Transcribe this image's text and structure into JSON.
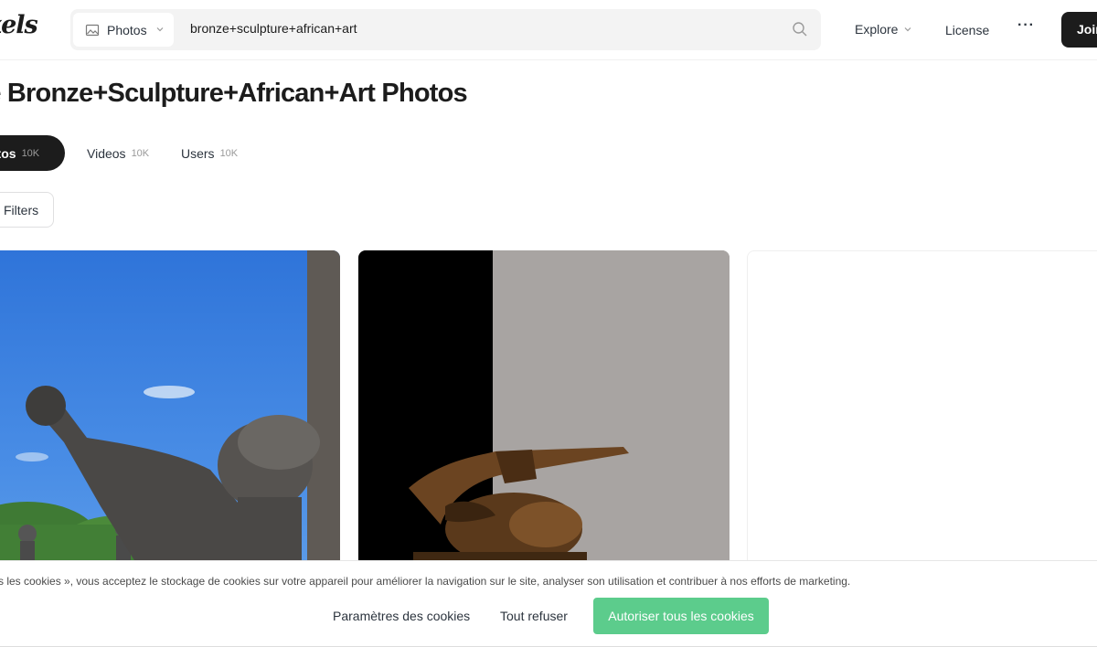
{
  "header": {
    "logo_text": "xels",
    "media_select_label": "Photos",
    "search_query": "bronze+sculpture+african+art",
    "nav_explore": "Explore",
    "nav_license": "License",
    "nav_more": "···",
    "join_label": "Join"
  },
  "page": {
    "title": "ee Bronze+Sculpture+African+Art Photos"
  },
  "tabs": [
    {
      "label": "otos",
      "count": "10K",
      "active": true
    },
    {
      "label": "Videos",
      "count": "10K",
      "active": false
    },
    {
      "label": "Users",
      "count": "10K",
      "active": false
    }
  ],
  "filters_label": "Filters",
  "photos": [
    {
      "subject": "bronze statue with raised fist against blue sky"
    },
    {
      "subject": "bronze sculpture of reclining figure"
    },
    {
      "subject": "loading placeholder"
    }
  ],
  "cookie_banner": {
    "text": "s les cookies », vous acceptez le stockage de cookies sur votre appareil pour améliorer la navigation sur le site, analyser son utilisation et contribuer à nos efforts de marketing.",
    "settings_label": "Paramètres des cookies",
    "refuse_label": "Tout refuser",
    "accept_label": "Autoriser tous les cookies"
  },
  "colors": {
    "accent_green": "#5ccc8c",
    "dark": "#1c1c1c"
  },
  "icons": {
    "media_select": "image-icon",
    "media_chevron": "chevron-down-icon",
    "search": "search-icon",
    "explore_chevron": "chevron-down-icon",
    "filters": "filters-icon"
  }
}
